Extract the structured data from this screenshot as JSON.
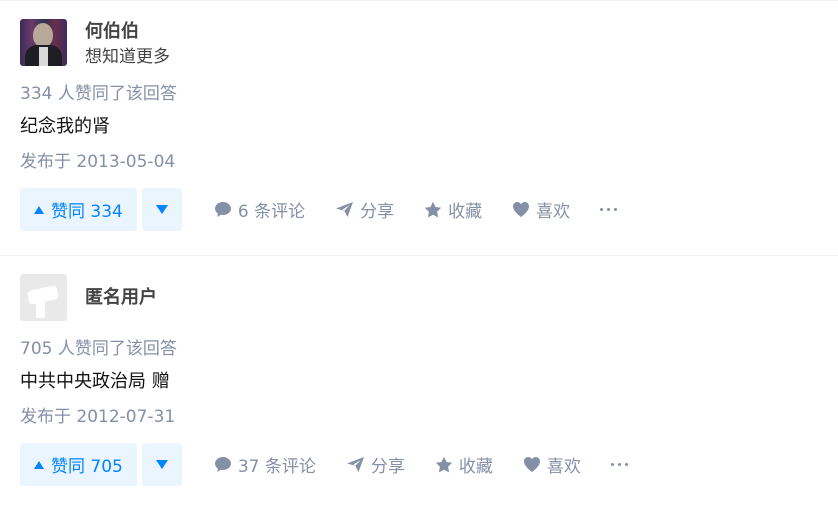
{
  "answers": [
    {
      "author_name": "何伯伯",
      "author_headline": "想知道更多",
      "vote_count_text": "334 人赞同了该回答",
      "content": "纪念我的肾",
      "publish_date": "发布于 2013-05-04",
      "vote_up_label": "赞同 334",
      "comment_label": "6 条评论",
      "share_label": "分享",
      "favorite_label": "收藏",
      "like_label": "喜欢"
    },
    {
      "author_name": "匿名用户",
      "author_headline": "",
      "vote_count_text": "705 人赞同了该回答",
      "content": "中共中央政治局 赠",
      "publish_date": "发布于 2012-07-31",
      "vote_up_label": "赞同 705",
      "comment_label": "37 条评论",
      "share_label": "分享",
      "favorite_label": "收藏",
      "like_label": "喜欢"
    }
  ],
  "colors": {
    "accent": "#0084ff",
    "accent_bg": "#ebf5ff",
    "muted": "#8590a6"
  },
  "icons": [
    "comment-icon",
    "share-icon",
    "star-icon",
    "heart-icon",
    "more-icon",
    "vote-up-icon",
    "vote-down-icon"
  ]
}
